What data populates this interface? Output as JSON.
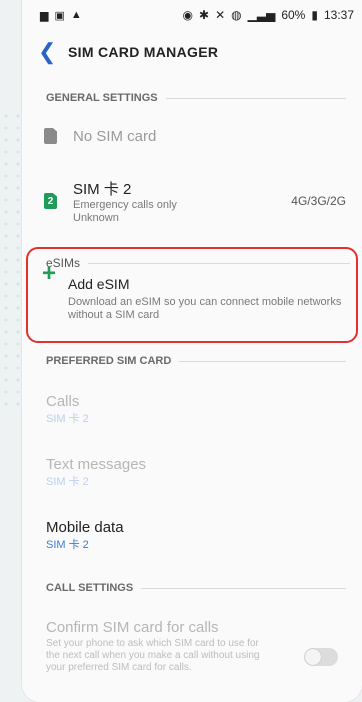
{
  "status": {
    "battery": "60%",
    "time": "13:37"
  },
  "appbar": {
    "title": "SIM CARD MANAGER"
  },
  "general": {
    "header": "GENERAL SETTINGS",
    "sim1_label": "No SIM card",
    "sim2_label": "SIM 卡 2",
    "sim2_badge": "2",
    "sim2_sub1": "Emergency calls only",
    "sim2_sub2": "Unknown",
    "sim2_network": "4G/3G/2G"
  },
  "esim": {
    "header": "eSIMs",
    "add_title": "Add eSIM",
    "add_desc": "Download an eSIM so you can connect mobile networks without a SIM card"
  },
  "preferred": {
    "header": "PREFERRED SIM CARD",
    "calls_label": "Calls",
    "calls_value": "SIM 卡 2",
    "text_label": "Text messages",
    "text_value": "SIM 卡 2",
    "data_label": "Mobile data",
    "data_value": "SIM 卡 2"
  },
  "call_settings": {
    "header": "CALL SETTINGS",
    "confirm_title": "Confirm SIM card for calls",
    "confirm_desc": "Set your phone to ask which SIM card to use for the next call when you make a call without using your preferred SIM card for calls."
  }
}
